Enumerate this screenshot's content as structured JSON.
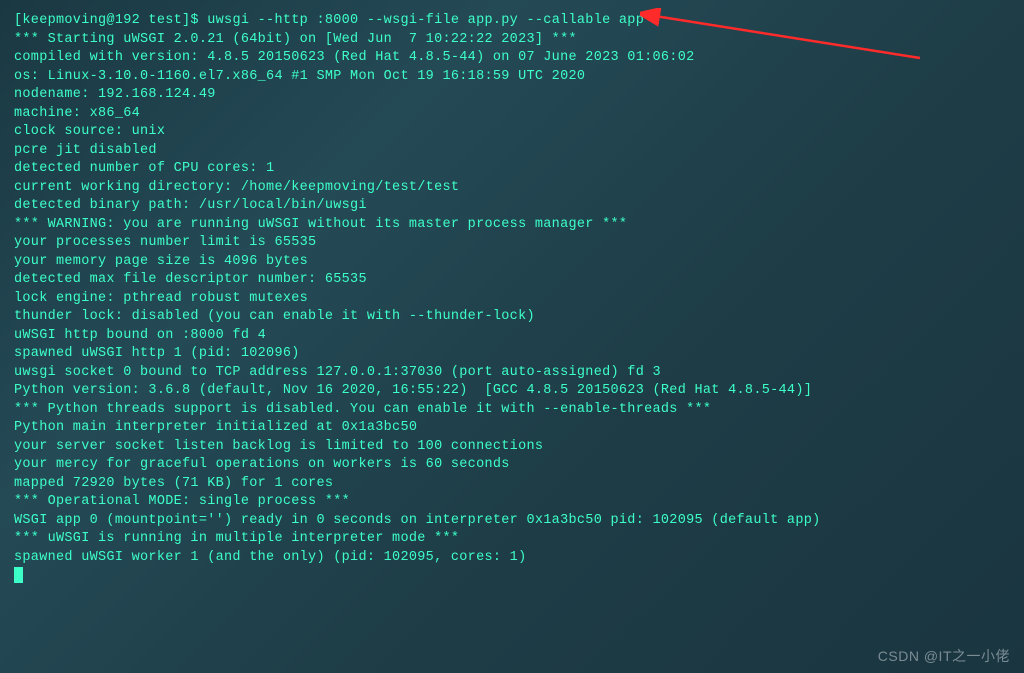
{
  "prompt": {
    "prefix": "[keepmoving@192 test]$ ",
    "command": "uwsgi --http :8000 --wsgi-file app.py --callable app"
  },
  "output_lines": [
    "*** Starting uWSGI 2.0.21 (64bit) on [Wed Jun  7 10:22:22 2023] ***",
    "compiled with version: 4.8.5 20150623 (Red Hat 4.8.5-44) on 07 June 2023 01:06:02",
    "os: Linux-3.10.0-1160.el7.x86_64 #1 SMP Mon Oct 19 16:18:59 UTC 2020",
    "nodename: 192.168.124.49",
    "machine: x86_64",
    "clock source: unix",
    "pcre jit disabled",
    "detected number of CPU cores: 1",
    "current working directory: /home/keepmoving/test/test",
    "detected binary path: /usr/local/bin/uwsgi",
    "*** WARNING: you are running uWSGI without its master process manager ***",
    "your processes number limit is 65535",
    "your memory page size is 4096 bytes",
    "detected max file descriptor number: 65535",
    "lock engine: pthread robust mutexes",
    "thunder lock: disabled (you can enable it with --thunder-lock)",
    "uWSGI http bound on :8000 fd 4",
    "spawned uWSGI http 1 (pid: 102096)",
    "uwsgi socket 0 bound to TCP address 127.0.0.1:37030 (port auto-assigned) fd 3",
    "Python version: 3.6.8 (default, Nov 16 2020, 16:55:22)  [GCC 4.8.5 20150623 (Red Hat 4.8.5-44)]",
    "*** Python threads support is disabled. You can enable it with --enable-threads ***",
    "Python main interpreter initialized at 0x1a3bc50",
    "your server socket listen backlog is limited to 100 connections",
    "your mercy for graceful operations on workers is 60 seconds",
    "mapped 72920 bytes (71 KB) for 1 cores",
    "*** Operational MODE: single process ***",
    "WSGI app 0 (mountpoint='') ready in 0 seconds on interpreter 0x1a3bc50 pid: 102095 (default app)",
    "*** uWSGI is running in multiple interpreter mode ***",
    "spawned uWSGI worker 1 (and the only) (pid: 102095, cores: 1)"
  ],
  "watermark": "CSDN @IT之一小佬"
}
